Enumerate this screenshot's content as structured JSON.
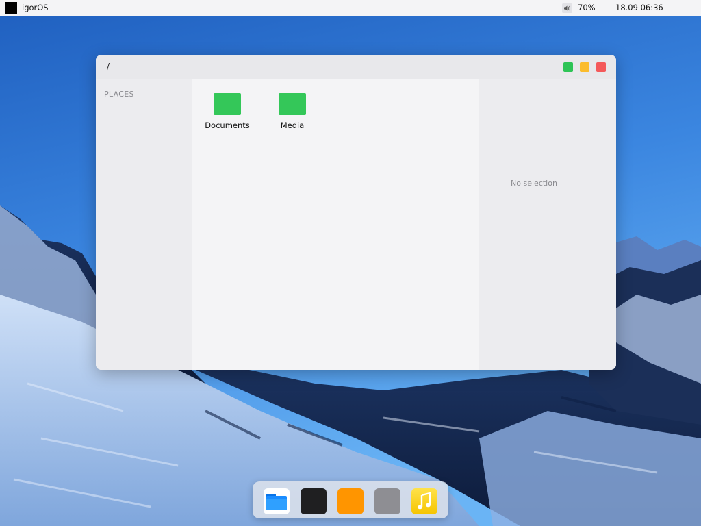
{
  "menubar": {
    "os_name": "igorOS",
    "volume": "70%",
    "datetime": "18.09 06:36",
    "sound_icon": "speaker-icon"
  },
  "window": {
    "path": "/",
    "buttons": {
      "maximize_color": "#2ec456",
      "minimize_color": "#fbbc2d",
      "close_color": "#f4595a"
    },
    "sidebar": {
      "heading": "PLACES"
    },
    "items": [
      {
        "name": "Documents",
        "icon": "folder-icon",
        "color": "#34c759"
      },
      {
        "name": "Media",
        "icon": "folder-icon",
        "color": "#34c759"
      }
    ],
    "preview": {
      "empty_text": "No selection"
    }
  },
  "dock": {
    "apps": [
      {
        "id": "files",
        "icon": "files-app-icon",
        "color": "#1a8cff"
      },
      {
        "id": "terminal",
        "icon": "terminal-app-icon",
        "color": "#1f1f21"
      },
      {
        "id": "orange",
        "icon": "orange-app-icon",
        "color": "#ff9500"
      },
      {
        "id": "gray",
        "icon": "gray-app-icon",
        "color": "#8e8e93"
      },
      {
        "id": "music",
        "icon": "music-app-icon",
        "color": "#f5c400"
      }
    ]
  }
}
